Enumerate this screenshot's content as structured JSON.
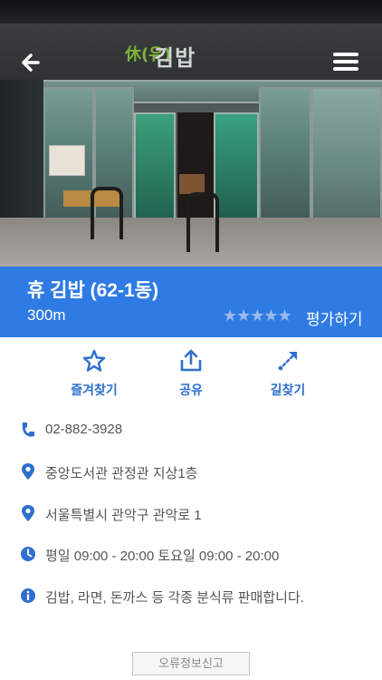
{
  "header": {
    "sign_text": "김밥",
    "sign_mark": "休(유)"
  },
  "place": {
    "name": "휴 김밥  (62-1동)",
    "distance": "300m",
    "rating_stars": "★★★★★",
    "rate_label": "평가하기"
  },
  "actions": [
    {
      "label": "즐겨찾기",
      "icon": "star-icon"
    },
    {
      "label": "공유",
      "icon": "share-icon"
    },
    {
      "label": "길찾기",
      "icon": "directions-icon"
    }
  ],
  "info": {
    "phone": "02-882-3928",
    "location": "중앙도서관 관정관  지상1층",
    "address": "서울특별시 관악구 관악로 1",
    "hours": "평일 09:00 - 20:00 토요일 09:00 - 20:00",
    "description": "김밥, 라면, 돈까스 등 각종 분식류 판매합니다."
  },
  "report_label": "오류정보신고",
  "colors": {
    "accent": "#2f7be4",
    "icon_blue": "#2f6fcf"
  }
}
